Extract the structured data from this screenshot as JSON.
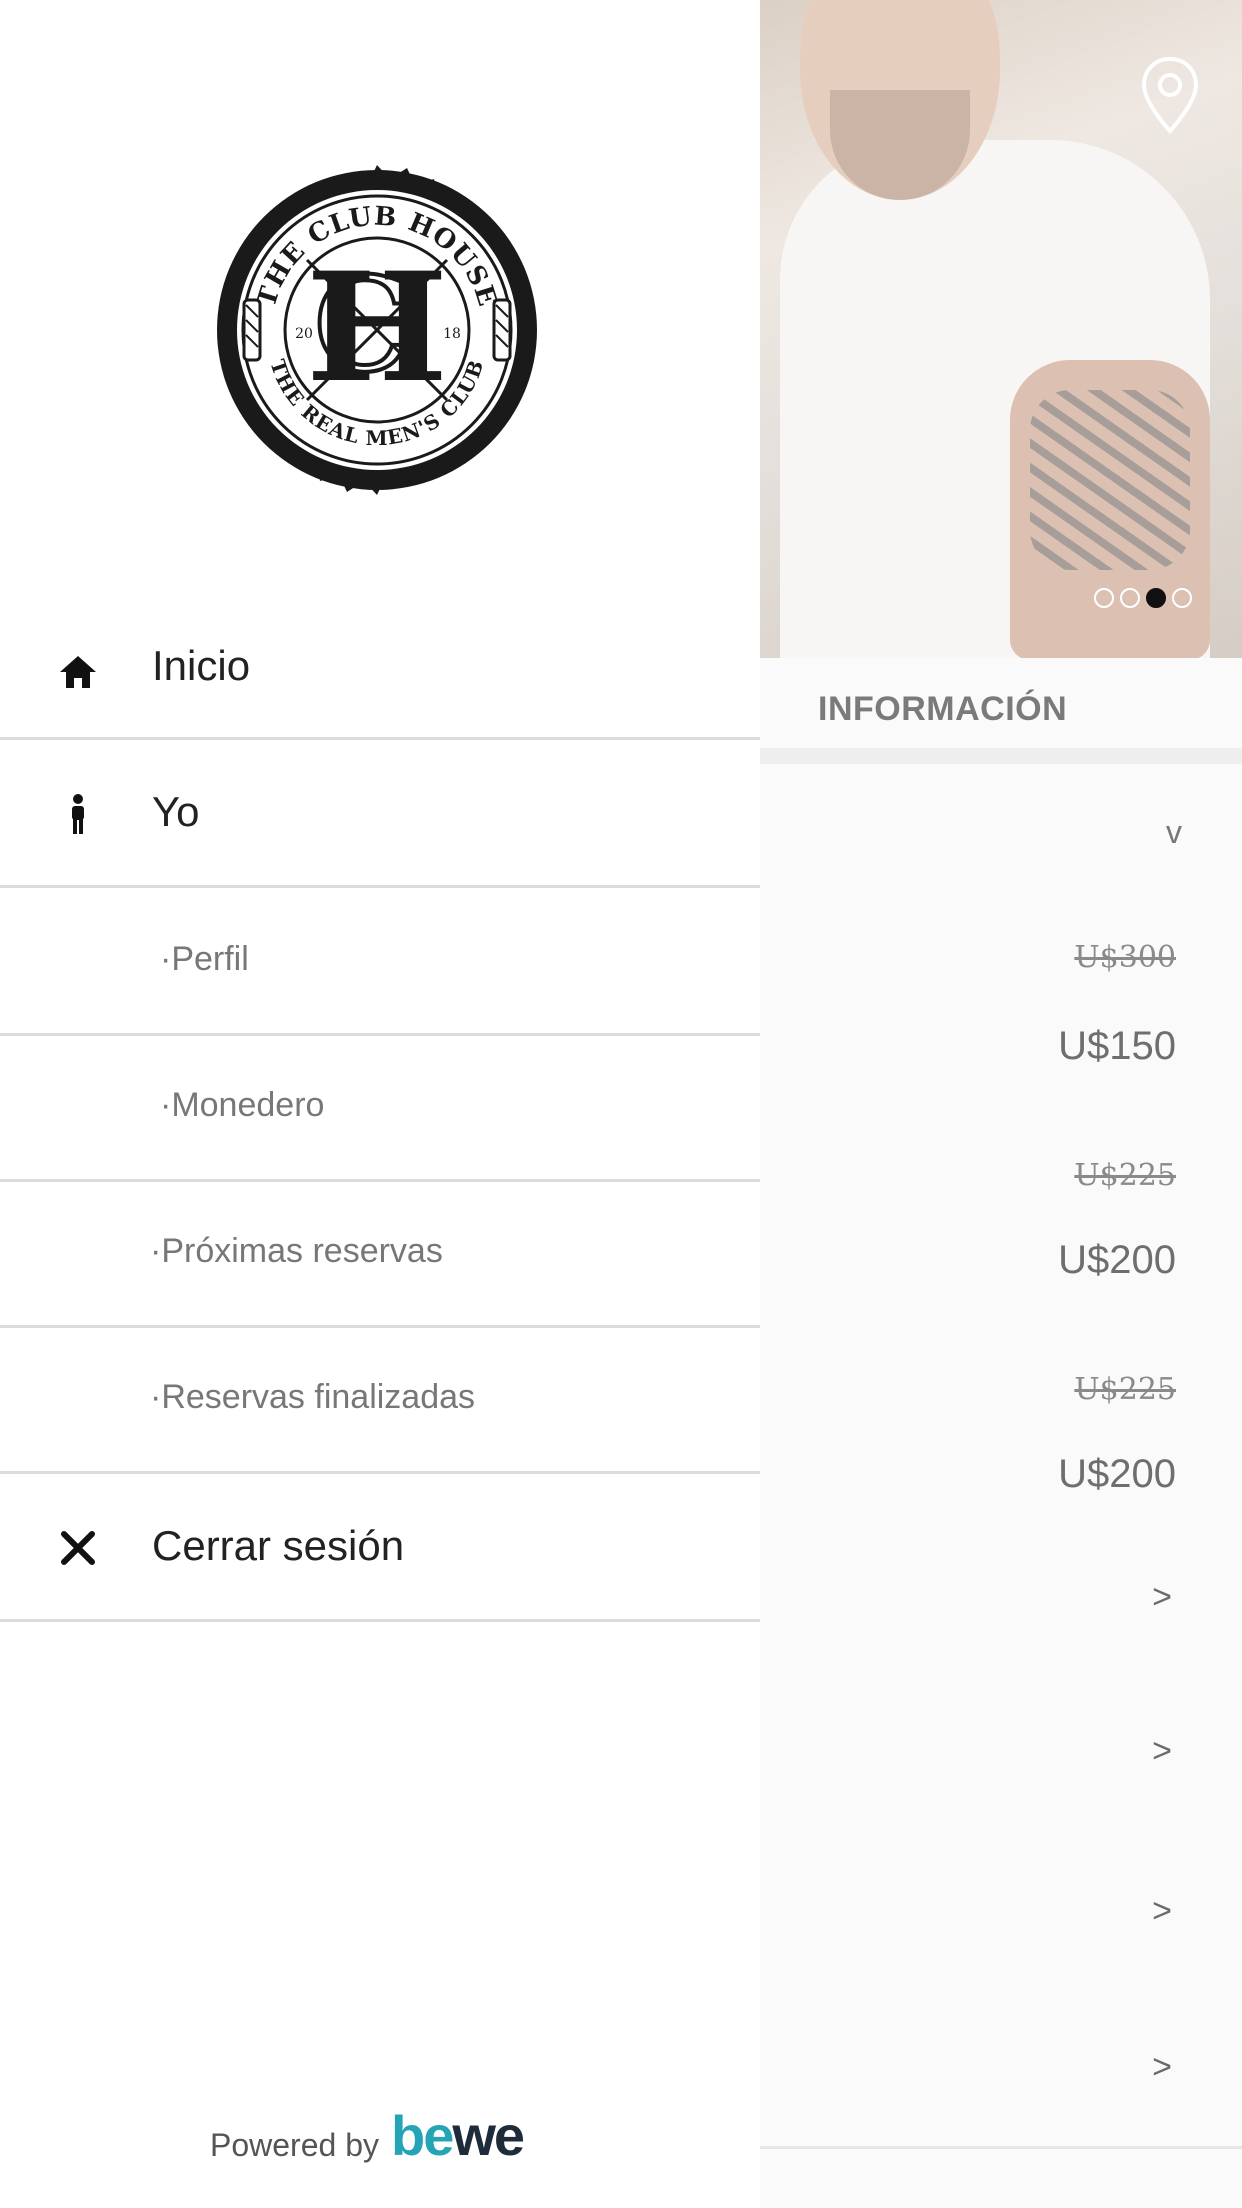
{
  "drawer": {
    "logo": {
      "top_text": "THE CLUB HOUSE",
      "bottom_text": "THE REAL MEN'S CLUB",
      "year_left": "20",
      "year_right": "18"
    },
    "items": [
      {
        "label": "Inicio",
        "icon": "home-icon"
      },
      {
        "label": "Yo",
        "icon": "person-icon"
      },
      {
        "label": "·Perfil"
      },
      {
        "label": "·Monedero"
      },
      {
        "label": "·Próximas reservas"
      },
      {
        "label": "·Reservas finalizadas"
      },
      {
        "label": "Cerrar sesión",
        "icon": "close-icon"
      }
    ],
    "footer": {
      "powered_by": "Powered by",
      "brand_be": "be",
      "brand_we": "we"
    }
  },
  "background": {
    "hero": {
      "icon": "location-pin-icon",
      "dots_total": 4,
      "active_dot": 3
    },
    "section_title": "INFORMACIÓN",
    "dropdown_chevron": "v",
    "prices": [
      {
        "old": "U$300",
        "new": "U$150"
      },
      {
        "old": "U$225",
        "new": "U$200"
      },
      {
        "old": "U$225",
        "new": "U$200"
      }
    ],
    "nav_arrows": [
      ">",
      ">",
      ">",
      ">"
    ]
  }
}
